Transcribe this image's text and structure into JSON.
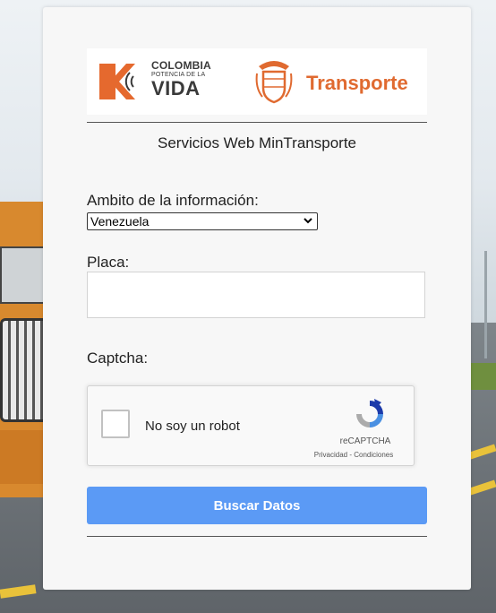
{
  "header": {
    "brand_line1": "COLOMBIA",
    "brand_line2": "POTENCIA DE LA",
    "brand_line3": "VIDA",
    "ministry": "Transporte"
  },
  "form": {
    "subtitle": "Servicios Web MinTransporte",
    "ambito_label": "Ambito de la información:",
    "ambito_selected": "Venezuela",
    "placa_label": "Placa:",
    "placa_value": "",
    "captcha_label": "Captcha:",
    "submit_label": "Buscar Datos"
  },
  "recaptcha": {
    "checkbox_label": "No soy un robot",
    "brand": "reCAPTCHA",
    "links": "Privacidad - Condiciones"
  },
  "colors": {
    "accent_button": "#5b9af5",
    "brand_orange": "#e06a30"
  },
  "icons": {
    "brand_mark": "colombia-vida-icon",
    "seal": "coat-of-arms-icon",
    "select_arrow": "chevron-down-icon",
    "recaptcha": "recaptcha-icon"
  }
}
